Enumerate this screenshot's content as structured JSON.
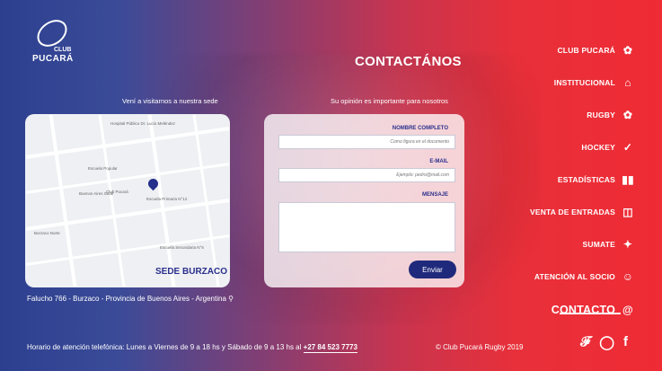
{
  "brand": {
    "club": "CLUB",
    "name": "PUCARÁ"
  },
  "page": {
    "title": "CONTACTÁNOS",
    "subtitle_left": "Vení a visitarnos a nuestra sede",
    "subtitle_right": "Su opinión es importante para nosotros"
  },
  "map": {
    "sede_label": "SEDE BURZACO",
    "labels": [
      "Hospital Público Dr. Lucio Meléndez",
      "Escuela Popular",
      "Buenos Aires Sede",
      "Club Pucará",
      "Escuela Primaria N°12",
      "Burzaco Norte",
      "Escuela Secundaria N°6"
    ]
  },
  "address": "Falucho 766 - Burzaco - Provincia de Buenos Aires - Argentina",
  "form": {
    "name_label": "NOMBRE COMPLETO",
    "name_placeholder": "Como figura en el documento",
    "email_label": "E-MAIL",
    "email_placeholder": "Ejemplo: pedro@mail.com",
    "message_label": "MENSAJE",
    "submit_label": "Enviar"
  },
  "nav": [
    {
      "label": "CLUB PUCARÁ",
      "icon": "rugby-ball-icon"
    },
    {
      "label": "INSTITUCIONAL",
      "icon": "building-icon"
    },
    {
      "label": "RUGBY",
      "icon": "rugby-ball-icon"
    },
    {
      "label": "HOCKEY",
      "icon": "hockey-stick-icon"
    },
    {
      "label": "ESTADÍSTICAS",
      "icon": "stats-icon"
    },
    {
      "label": "VENTA DE ENTRADAS",
      "icon": "ticket-icon"
    },
    {
      "label": "SUMATE",
      "icon": "star-icon"
    },
    {
      "label": "ATENCIÓN AL SOCIO",
      "icon": "support-icon"
    },
    {
      "label": "CONTACTO",
      "icon": "at-icon"
    }
  ],
  "footer": {
    "hours": "Horario de atención telefónica: Lunes a Viernes de 9 a 18 hs y Sábado de 9 a 13 hs al",
    "phone": "+27 84 523 7773",
    "copyright": "© Club Pucará Rugby 2019"
  },
  "social": [
    "twitter-icon",
    "instagram-icon",
    "facebook-icon"
  ]
}
